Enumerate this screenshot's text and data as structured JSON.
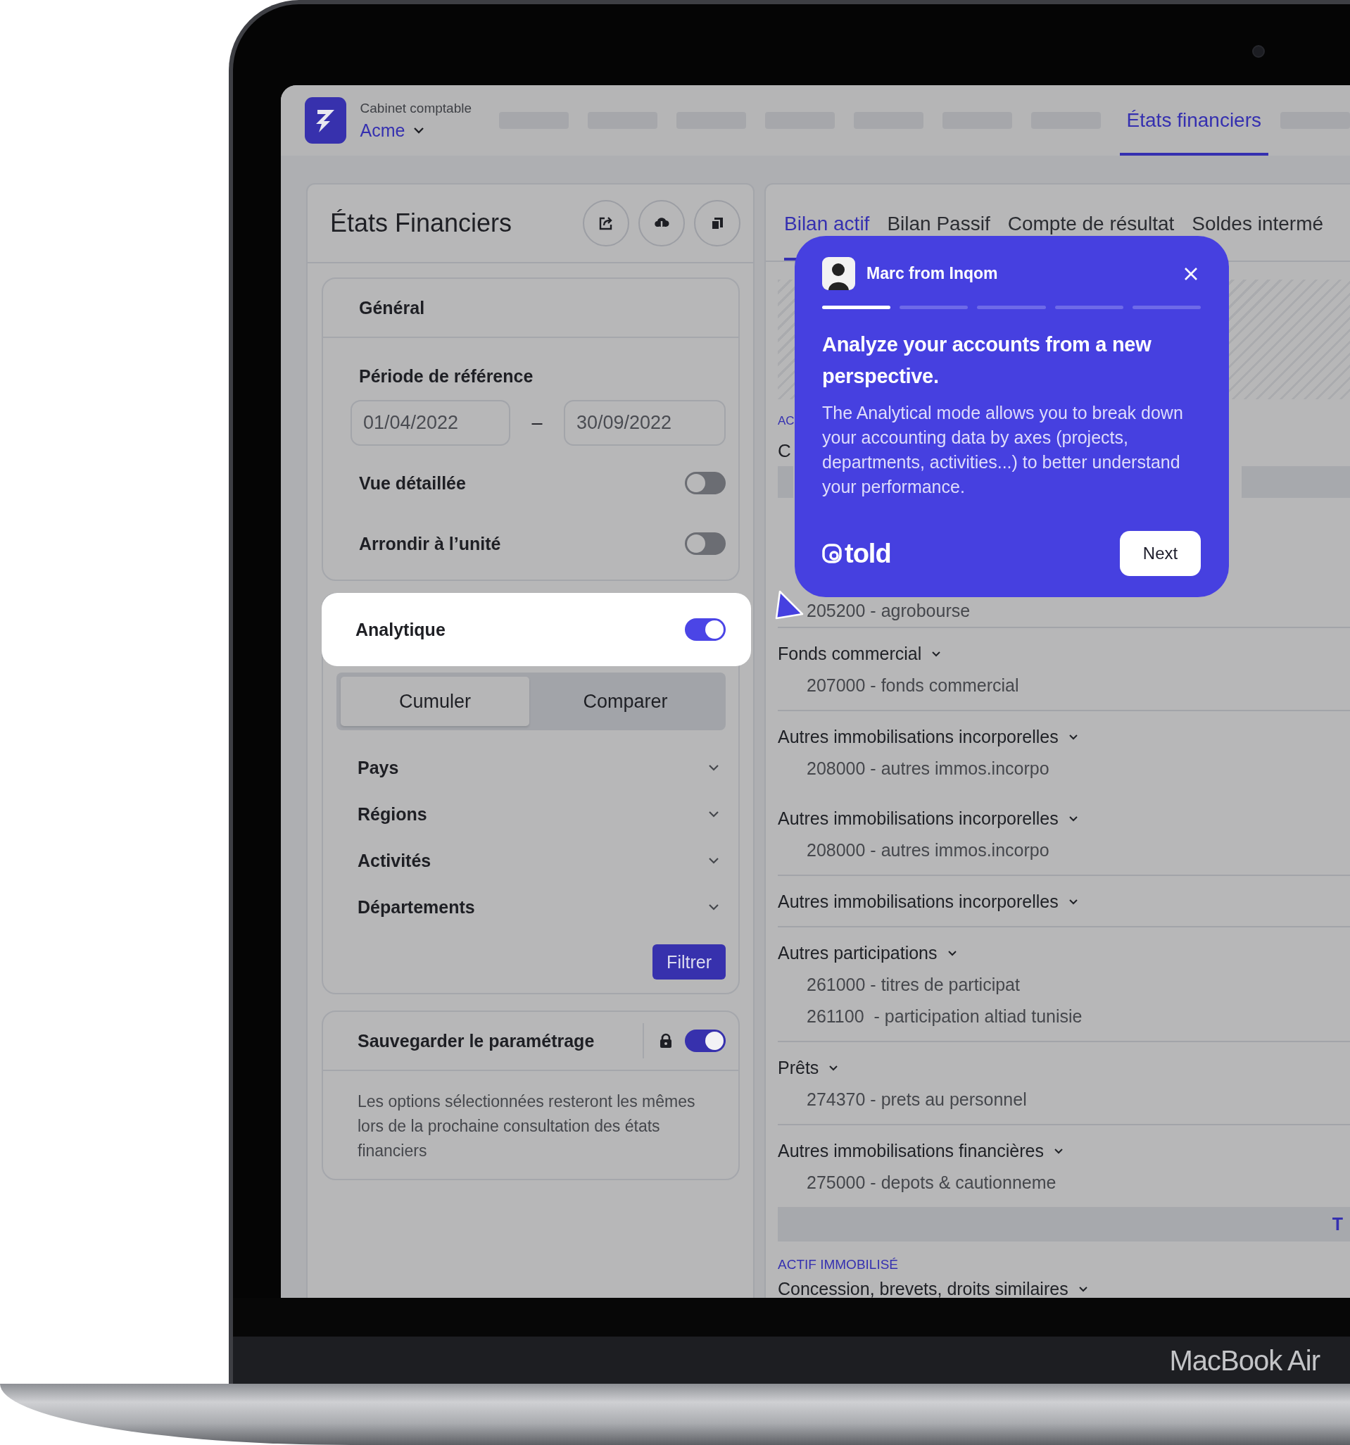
{
  "laptop": {
    "brand": "MacBook Air"
  },
  "header": {
    "org_label": "Cabinet comptable",
    "org_name": "Acme",
    "nav": [
      {
        "label": "États financiers",
        "selected": true
      }
    ]
  },
  "sidebar": {
    "title": "États Financiers",
    "general": {
      "title": "Général",
      "period_label": "Période de référence",
      "start_date": "01/04/2022",
      "separator": "–",
      "end_date": "30/09/2022",
      "toggles": [
        {
          "label": "Vue détaillée",
          "on": false
        },
        {
          "label": "Arrondir à l’unité",
          "on": false
        }
      ]
    },
    "analytics": {
      "label": "Analytique",
      "on": true,
      "modes": [
        {
          "label": "Cumuler",
          "selected": true
        },
        {
          "label": "Comparer",
          "selected": false
        }
      ],
      "axes": [
        "Pays",
        "Régions",
        "Activités",
        "Départements"
      ],
      "filter_button": "Filtrer"
    },
    "save_settings": {
      "label": "Sauvegarder le paramétrage",
      "on": true,
      "description": "Les options sélectionnées resteront les mêmes lors de la prochaine consultation des états financiers"
    }
  },
  "content": {
    "tabs": [
      {
        "label": "Bilan actif",
        "selected": true
      },
      {
        "label": "Bilan Passif",
        "selected": false
      },
      {
        "label": "Compte de résultat",
        "selected": false
      },
      {
        "label": "Soldes intermé",
        "selected": false
      }
    ],
    "partial_section": "AC",
    "partial_row": "C",
    "rows": [
      {
        "kind": "account",
        "text": "205200 - agrobourse"
      },
      {
        "kind": "divider"
      },
      {
        "kind": "group",
        "text": "Fonds commercial"
      },
      {
        "kind": "account",
        "text": "207000 - fonds commercial"
      },
      {
        "kind": "divider"
      },
      {
        "kind": "group",
        "text": "Autres immobilisations incorporelles"
      },
      {
        "kind": "account",
        "text": "208000 - autres immos.incorpo"
      },
      {
        "kind": "group",
        "text": "Autres immobilisations incorporelles"
      },
      {
        "kind": "account",
        "text": "208000 - autres immos.incorpo"
      },
      {
        "kind": "divider"
      },
      {
        "kind": "group",
        "text": "Autres immobilisations incorporelles"
      },
      {
        "kind": "divider"
      },
      {
        "kind": "group",
        "text": "Autres participations"
      },
      {
        "kind": "account",
        "text": "261000 - titres de participat"
      },
      {
        "kind": "account",
        "text": "261100  - participation altiad tunisie"
      },
      {
        "kind": "divider"
      },
      {
        "kind": "group",
        "text": "Prêts"
      },
      {
        "kind": "account",
        "text": "274370 - prets au personnel"
      },
      {
        "kind": "divider"
      },
      {
        "kind": "group",
        "text": "Autres immobilisations financières"
      },
      {
        "kind": "account",
        "text": "275000 - depots & cautionneme"
      }
    ],
    "total_partial": "T",
    "section": "ACTIF IMMOBILISÉ",
    "next_group": "Concession, brevets, droits similaires"
  },
  "tour": {
    "sender": "Marc from Inqom",
    "progress": [
      {
        "done": true
      },
      {
        "done": false
      },
      {
        "done": false
      },
      {
        "done": false
      },
      {
        "done": false
      }
    ],
    "title": "Analyze your accounts from a new perspective.",
    "body": "The Analytical mode allows you to break down your accounting data by axes (projects, departments, activities...) to better understand your performance.",
    "brand": "told",
    "next_button": "Next"
  }
}
